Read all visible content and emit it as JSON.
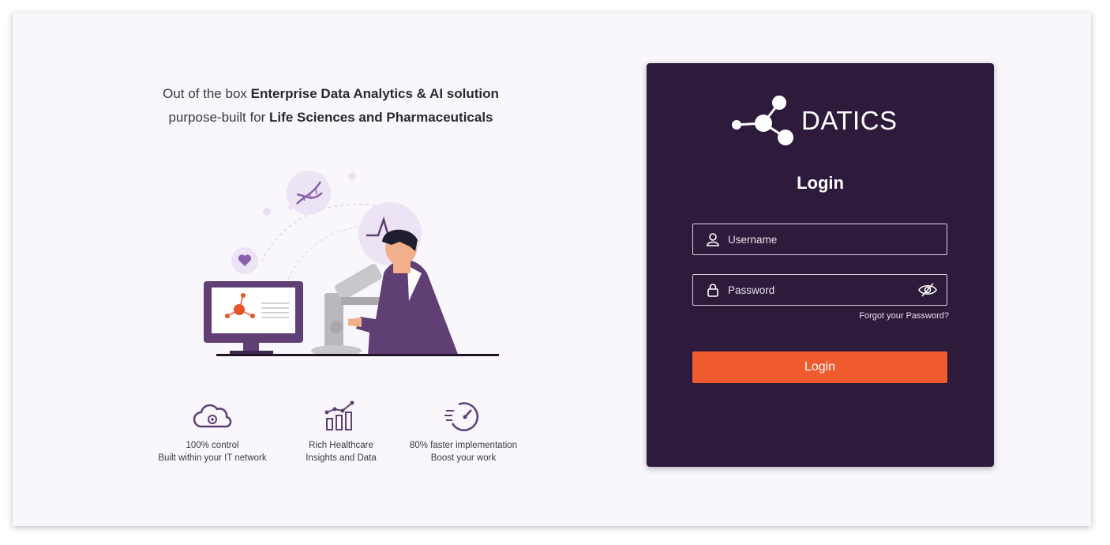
{
  "hero": {
    "line1_prefix": "Out of the box ",
    "line1_bold": "Enterprise Data  Analytics & AI solution",
    "line2_prefix": "purpose-built for ",
    "line2_bold": "Life Sciences and Pharmaceuticals"
  },
  "features": [
    {
      "icon": "cloud-gear-icon",
      "line1": "100% control",
      "line2": "Built within your IT network"
    },
    {
      "icon": "bar-chart-icon",
      "line1": "Rich Healthcare",
      "line2": "Insights and Data"
    },
    {
      "icon": "speedometer-icon",
      "line1": "80% faster implementation",
      "line2": "Boost your work"
    }
  ],
  "login": {
    "brand": "DATICS",
    "title": "Login",
    "username_placeholder": "Username",
    "password_placeholder": "Password",
    "forgot_label": "Forgot your Password?",
    "button_label": "Login"
  },
  "colors": {
    "card_bg": "#2e1b3c",
    "accent": "#ef5b2c",
    "page_bg": "#f9f7fc",
    "illustration_purple": "#5f3f74"
  }
}
